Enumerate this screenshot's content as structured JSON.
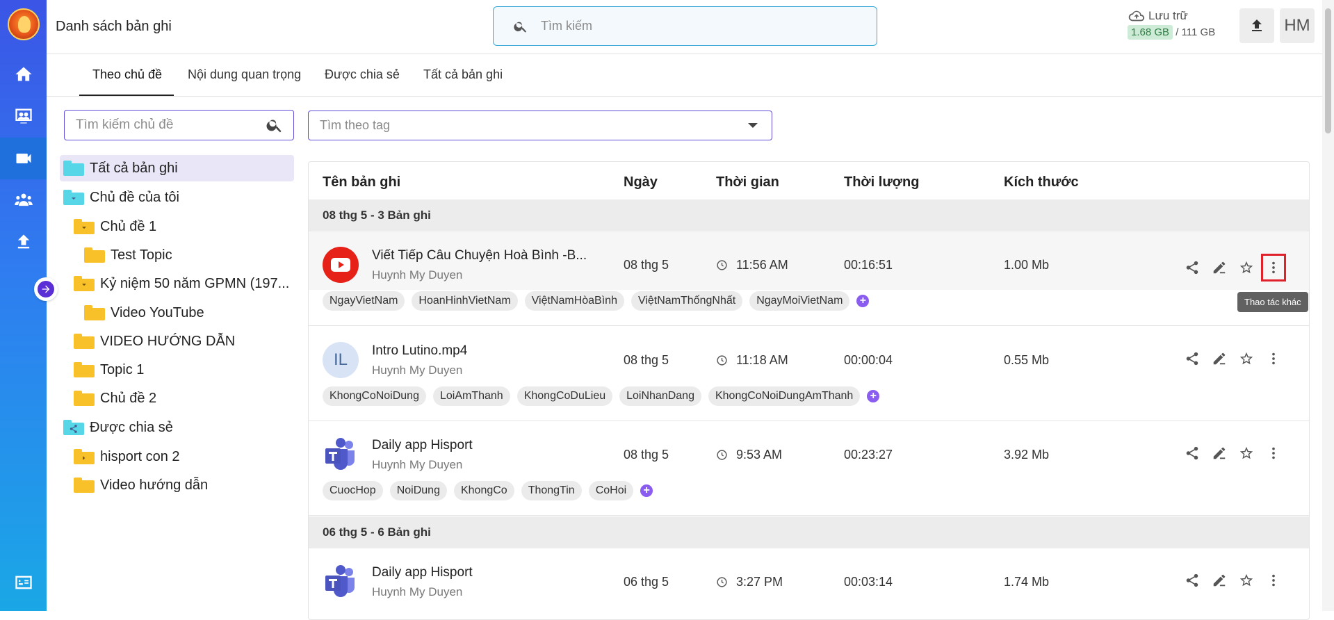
{
  "header": {
    "title": "Danh sách bản ghi",
    "search_placeholder": "Tìm kiếm",
    "storage_label": "Lưu trữ",
    "storage_used": "1.68 GB",
    "storage_total": "/ 111 GB",
    "avatar_initials": "HM"
  },
  "tabs": [
    {
      "label": "Theo chủ đề"
    },
    {
      "label": "Nội dung quan trọng"
    },
    {
      "label": "Được chia sẻ"
    },
    {
      "label": "Tất cả bản ghi"
    }
  ],
  "topics": {
    "search_placeholder": "Tìm kiếm chủ đề",
    "items": [
      {
        "label": "Tất cả bản ghi"
      },
      {
        "label": "Chủ đề của tôi"
      },
      {
        "label": "Chủ đề 1"
      },
      {
        "label": "Test Topic"
      },
      {
        "label": "Kỷ niệm 50 năm GPMN (197..."
      },
      {
        "label": "Video YouTube"
      },
      {
        "label": "VIDEO HƯỚNG DẪN"
      },
      {
        "label": "Topic 1"
      },
      {
        "label": "Chủ đề 2"
      },
      {
        "label": "Được chia sẻ"
      },
      {
        "label": "hisport con 2"
      },
      {
        "label": "Video hướng dẫn"
      }
    ]
  },
  "tag_search_placeholder": "Tìm theo tag",
  "table": {
    "headers": {
      "name": "Tên bản ghi",
      "date": "Ngày",
      "time": "Thời gian",
      "duration": "Thời lượng",
      "size": "Kích thước"
    },
    "groups": [
      {
        "label": "08 thg 5 - 3 Bản ghi"
      },
      {
        "label": "06 thg 5 - 6 Bản ghi"
      }
    ],
    "rows": [
      {
        "name": "Viết Tiếp Câu Chuyện Hoà Bình -B...",
        "owner": "Huynh My Duyen",
        "date": "08 thg 5",
        "time": "11:56 AM",
        "duration": "00:16:51",
        "size": "1.00 Mb",
        "tags": [
          "NgayVietNam",
          "HoanHinhVietNam",
          "ViệtNamHòaBình",
          "ViệtNamThốngNhất",
          "NgayMoiVietNam"
        ]
      },
      {
        "name": "Intro Lutino.mp4",
        "owner": "Huynh My Duyen",
        "initials": "IL",
        "date": "08 thg 5",
        "time": "11:18 AM",
        "duration": "00:00:04",
        "size": "0.55 Mb",
        "tags": [
          "KhongCoNoiDung",
          "LoiAmThanh",
          "KhongCoDuLieu",
          "LoiNhanDang",
          "KhongCoNoiDungAmThanh"
        ]
      },
      {
        "name": "Daily app Hisport",
        "owner": "Huynh My Duyen",
        "date": "08 thg 5",
        "time": "9:53 AM",
        "duration": "00:23:27",
        "size": "3.92 Mb",
        "tags": [
          "CuocHop",
          "NoiDung",
          "KhongCo",
          "ThongTin",
          "CoHoi"
        ]
      },
      {
        "name": "Daily app Hisport",
        "owner": "Huynh My Duyen",
        "date": "06 thg 5",
        "time": "3:27 PM",
        "duration": "00:03:14",
        "size": "1.74 Mb",
        "tags": []
      }
    ]
  },
  "tooltip": "Thao tác khác",
  "colors": {
    "accent": "#5b4bd6",
    "highlight_box": "#e0202a",
    "rail_top": "#3b55e6",
    "rail_bottom": "#1aa7e6"
  }
}
